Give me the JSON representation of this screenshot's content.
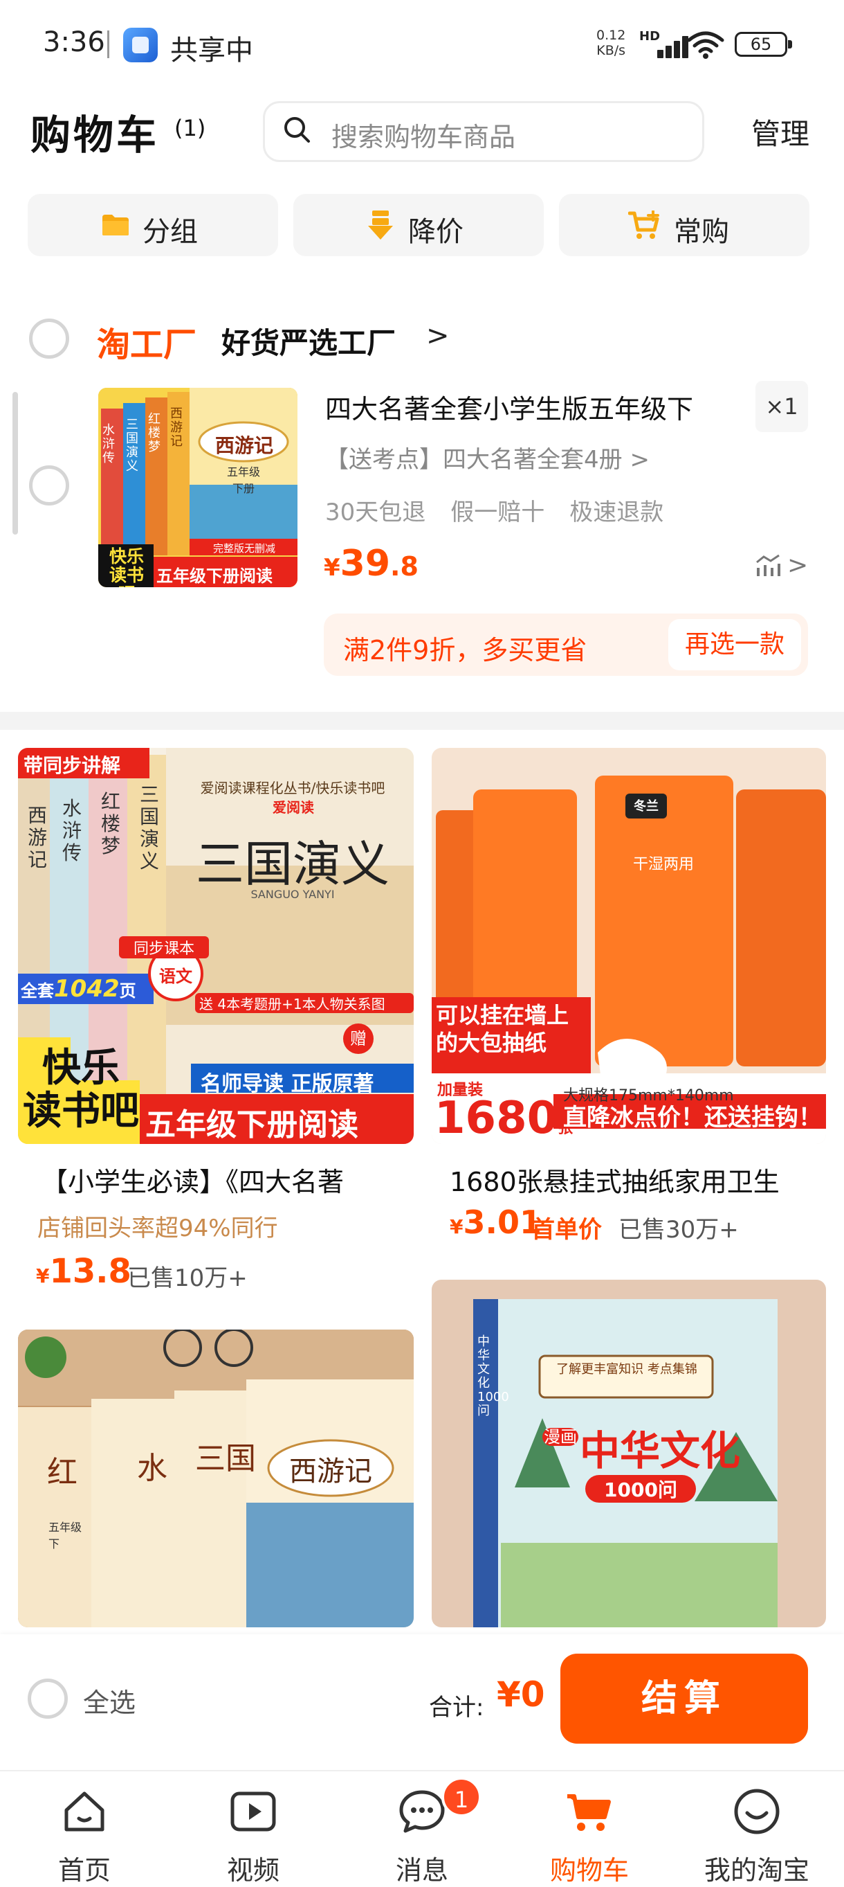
{
  "status_bar": {
    "time": "3:36",
    "share_label": "共享中",
    "net_speed_value": "0.12",
    "net_speed_unit": "KB/s",
    "network_type": "HD",
    "battery": "65"
  },
  "header": {
    "title": "购物车",
    "count": "(1)",
    "search_placeholder": "搜索购物车商品",
    "manage_label": "管理"
  },
  "quick_actions": [
    {
      "label": "分组",
      "icon": "folder-icon"
    },
    {
      "label": "降价",
      "icon": "price-drop-icon"
    },
    {
      "label": "常购",
      "icon": "cart-plus-icon"
    }
  ],
  "shop": {
    "brand": "淘工厂",
    "name": "好货严选工厂",
    "arrow": ">"
  },
  "cart_item": {
    "title": "四大名著全套小学生版五年级下",
    "quantity": "×1",
    "sku": "【送考点】四大名著全套4册 >",
    "tags": [
      "30天包退",
      "假一赔十",
      "极速退款"
    ],
    "price_symbol": "¥",
    "price_int": "39",
    "price_dec": ".8",
    "image_text": {
      "book_title": "西游记",
      "grade": "五年级下册",
      "badge1": "快乐读书吧",
      "badge2": "五年级下册阅读",
      "spines": [
        "水浒传",
        "三国演义",
        "红楼梦",
        "西游记"
      ],
      "banner": "完整版无删减"
    }
  },
  "promo": {
    "text": "满2件9折，多买更省",
    "button": "再选一款"
  },
  "recommendations": [
    {
      "title": "【小学生必读】《四大名著",
      "subtitle": "店铺回头率超94%同行",
      "price_symbol": "¥",
      "price": "13.8",
      "sold": "已售10万+",
      "image_text": {
        "corner": "带同步讲解",
        "series": "爱阅读课程化丛书/快乐读书吧",
        "logo": "爱阅读",
        "title": "三国演义",
        "pinyin": "SANGUO YANYI",
        "sync": "同步课本",
        "subject": "语文",
        "pages_prefix": "全套",
        "pages": "1042",
        "pages_suffix": "页",
        "gift_line": "送 4本考题册+1本人物关系图",
        "gift_badge": "赠",
        "guide": "名师导读  正版原著",
        "badge1": "快乐",
        "badge2": "读书吧",
        "grade": "五年级下册阅读",
        "spines": [
          "西游记",
          "水浒传",
          "红楼梦",
          "三国演义"
        ]
      }
    },
    {
      "title": "1680张悬挂式抽纸家用卫生",
      "price_symbol": "¥",
      "price": "3.01",
      "price_tag": "首单价",
      "sold": "已售30万+",
      "image_text": {
        "brand": "冬兰",
        "pack_label": "干湿两用",
        "hang": "可以挂在墙上的大包抽纸",
        "spec": "大规格175mm*140mm",
        "count_prefix": "加量装",
        "count": "1680",
        "count_unit": "张",
        "slogan": "直降冰点价！还送挂钩！"
      }
    },
    {
      "image_text": {
        "books": [
          "红",
          "水",
          "三国",
          "西游记"
        ],
        "grade": "五年级下"
      }
    },
    {
      "image_text": {
        "top": "了解更丰富知识 考点集锦",
        "prefix": "漫画",
        "title": "中华文化",
        "count": "1000问",
        "spine": "中华文化1000问"
      }
    }
  ],
  "checkout": {
    "select_all": "全选",
    "total_label": "合计:",
    "total_value": "¥0",
    "button": "结算"
  },
  "tabs": [
    {
      "label": "首页",
      "icon": "home-icon"
    },
    {
      "label": "视频",
      "icon": "video-icon"
    },
    {
      "label": "消息",
      "icon": "message-icon",
      "badge": "1"
    },
    {
      "label": "购物车",
      "icon": "cart-icon",
      "active": true
    },
    {
      "label": "我的淘宝",
      "icon": "profile-icon"
    }
  ],
  "colors": {
    "accent": "#ff5500",
    "price": "#ff4d00",
    "promo_bg": "#fff3ec"
  }
}
